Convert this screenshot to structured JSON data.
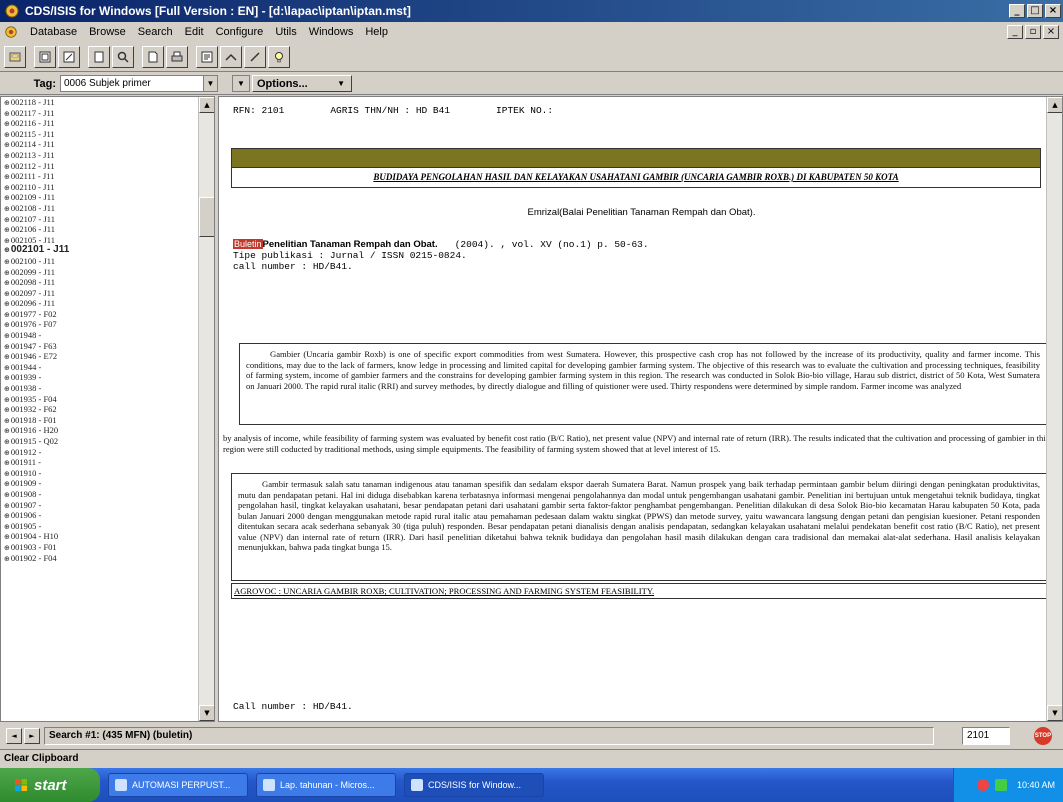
{
  "window": {
    "title": "CDS/ISIS for Windows [Full Version : EN] - [d:\\lapac\\iptan\\iptan.mst]",
    "controls": [
      "_",
      "□",
      "×"
    ],
    "mdi_controls": [
      "_",
      "▫",
      "×"
    ]
  },
  "menu": {
    "items": [
      "Database",
      "Browse",
      "Search",
      "Edit",
      "Configure",
      "Utils",
      "Windows",
      "Help"
    ]
  },
  "tagbar": {
    "label": "Tag:",
    "selected": "0006 Subjek primer",
    "options_label": "Options..."
  },
  "mfn_list": {
    "items": [
      "002118 - J11",
      "002117 - J11",
      "002116 - J11",
      "002115 - J11",
      "002114 - J11",
      "002113 - J11",
      "002112 - J11",
      "002111 - J11",
      "002110 - J11",
      "002109 - J11",
      "002108 - J11",
      "002107 - J11",
      "002106 - J11",
      "002105 - J11",
      "002101 - J11",
      "002100 - J11",
      "002099 - J11",
      "002098 - J11",
      "002097 - J11",
      "002096 - J11",
      "001977 - F02",
      "001976 - F07",
      "001948 -",
      "001947 - F63",
      "001946 - E72",
      "001944 -",
      "001939 -",
      "001938 -",
      "001935 - F04",
      "001932 - F62",
      "001918 - F01",
      "001916 - H20",
      "001915 - Q02",
      "001912 -",
      "001911 -",
      "001910 -",
      "001909 -",
      "001908 -",
      "001907 -",
      "001906 -",
      "001905 -",
      "001904 - H10",
      "001903 - F01",
      "001902 - F04"
    ],
    "current_index": 14
  },
  "record": {
    "header": {
      "rfn": "RFN: 2101",
      "agris": "AGRIS THN/NH : HD B41",
      "iptek": "IPTEK NO.:"
    },
    "title": "BUDIDAYA PENGOLAHAN HASIL DAN KELAYAKAN USAHATANI GAMBIR (UNCARIA GAMBIR ROXB.) DI KABUPATEN 50 KOTA",
    "author": "Emrizal(Balai Penelitian Tanaman Rempah dan Obat).",
    "source_highlight": "Buletin",
    "source_title": "Penelitian Tanaman Rempah dan Obat.",
    "source_detail": "(2004). , vol. XV (no.1) p. 50-63.",
    "tipe": "Tipe publikasi : Jurnal / ISSN 0215-0824.",
    "call_number": "call number : HD/B41.",
    "abstract_en": "Gambier (Uncaria gambir Roxb) is one of specific export commodities from west Sumatera. However, this prospective cash crop has not followed by the increase of its productivity, quality and farmer income. This conditions, may due to the lack of farmers, know ledge in processing and limited capital for developing gambier farming system. The objective of this research was to evaluate the cultivation and processing techniques, feasibility of farming system, income of gambier farmers and the constrains for developing gambier farming system in this region. The research was conducted in Solok Bio-bio village, Harau sub district, district of 50 Kota, West Sumatera on Januari 2000. The rapid rural italic (RRI) and survey methodes, by directly dialogue and filling of quistioner were used. Thirty respondens were determined by simple random. Farmer income was analyzed",
    "abstract_en_cont": "by analysis of income, while feasibility of farming system was evaluated by benefit cost ratio (B/C Ratio), net present value (NPV) and internal rate of return (IRR). The results indicated that the cultivation and processing of gambier in this region were still coducted by traditional methods, using simple equipments. The feasibility of farming system showed that at level interest of 15.",
    "abstract_id": "Gambir termasuk salah satu tanaman indigenous atau tanaman spesifik dan sedalam ekspor daerah Sumatera Barat. Namun prospek yang baik terhadap permintaan gambir belum diiringi dengan peningkatan produktivitas, mutu dan pendapatan petani. Hal ini diduga disebabkan karena terbatasnya informasi mengenai pengolahannya dan modal untuk pengembangan usahatani gambir. Penelitian ini bertujuan untuk mengetahui teknik budidaya, tingkat pengolahan hasil, tingkat kelayakan usahatani, besar pendapatan petani dari usahatani gambir serta faktor-faktor penghambat pengembangan. Penelitian dilakukan di desa Solok Bio-bio kecamatan Harau kabupaten 50 Kota, pada bulan Januari 2000 dengan menggunakan metode rapid rural italic atau pemahaman pedesaan dalam waktu singkat (PPWS) dan metode survey, yaitu wawancara langsung dengan petani dan pengisian kuesioner. Petani responden ditentukan secara acak sederhana sebanyak 30 (tiga puluh) responden. Besar pendapatan petani dianalisis dengan analisis pendapatan, sedangkan kelayakan usahatani melalui pendekatan benefit cost ratio (B/C Ratio), net present value (NPV) dan internal rate of return (IRR). Dari hasil penelitian diketahui bahwa teknik budidaya dan pengolahan hasil masih dilakukan dengan cara tradisional dan memakai alat-alat sederhana. Hasil analisis kelayakan menunjukkan, bahwa pada tingkat bunga 15.",
    "agrovoc": "AGROVOC : UNCARIA GAMBIR ROXB; CULTIVATION; PROCESSING AND FARMING SYSTEM FEASIBILITY.",
    "call_number2": "Call number :   HD/B41."
  },
  "status": {
    "nav_prev": "◄",
    "nav_next": "►",
    "search": "Search #1: (435 MFN) (buletin)",
    "mfn": "2101",
    "stop": "STOP"
  },
  "clipboard": "Clear Clipboard",
  "taskbar": {
    "start": "start",
    "items": [
      "AUTOMASI PERPUST...",
      "Lap. tahunan - Micros...",
      "CDS/ISIS for Window..."
    ],
    "clock": "10:40 AM"
  }
}
